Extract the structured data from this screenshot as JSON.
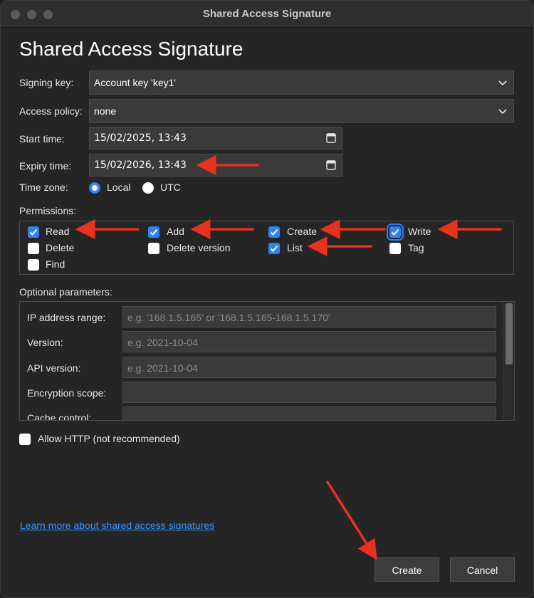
{
  "window": {
    "title": "Shared Access Signature"
  },
  "page": {
    "heading": "Shared Access Signature"
  },
  "form": {
    "signing_key": {
      "label": "Signing key:",
      "value": "Account key 'key1'"
    },
    "access_policy": {
      "label": "Access policy:",
      "value": "none"
    },
    "start_time": {
      "label": "Start time:",
      "value": "15/02/2025, 13:43"
    },
    "expiry_time": {
      "label": "Expiry time:",
      "value": "15/02/2026, 13:43"
    },
    "time_zone": {
      "label": "Time zone:",
      "options": [
        "Local",
        "UTC"
      ],
      "selected": "Local"
    }
  },
  "permissions": {
    "label": "Permissions:",
    "items": [
      {
        "label": "Read",
        "checked": true
      },
      {
        "label": "Add",
        "checked": true
      },
      {
        "label": "Create",
        "checked": true
      },
      {
        "label": "Write",
        "checked": true
      },
      {
        "label": "Delete",
        "checked": false
      },
      {
        "label": "Delete version",
        "checked": false
      },
      {
        "label": "List",
        "checked": true
      },
      {
        "label": "Tag",
        "checked": false
      },
      {
        "label": "Find",
        "checked": false
      }
    ]
  },
  "optional": {
    "label": "Optional parameters:",
    "fields": [
      {
        "label": "IP address range:",
        "placeholder": "e.g. '168.1.5.165' or '168.1.5.165-168.1.5.170'"
      },
      {
        "label": "Version:",
        "placeholder": "e.g. 2021-10-04"
      },
      {
        "label": "API version:",
        "placeholder": "e.g. 2021-10-04"
      },
      {
        "label": "Encryption scope:",
        "placeholder": ""
      },
      {
        "label": "Cache control:",
        "placeholder": ""
      }
    ]
  },
  "allow_http": {
    "label": "Allow HTTP (not recommended)",
    "checked": false
  },
  "footer": {
    "learn_more": "Learn more about shared access signatures",
    "create": "Create",
    "cancel": "Cancel"
  },
  "colors": {
    "accent": "#2f81f7",
    "link": "#3794ff",
    "annotation_arrow": "#e8321e"
  }
}
